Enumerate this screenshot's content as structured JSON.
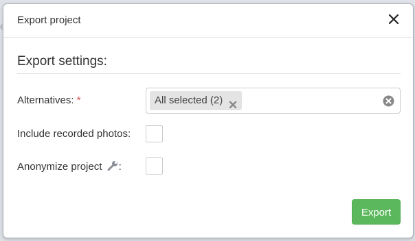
{
  "modal": {
    "title": "Export project",
    "close_icon": "close-icon"
  },
  "settings": {
    "heading": "Export settings:",
    "alternatives": {
      "label": "Alternatives:",
      "required_mark": "*",
      "selected_tag": "All selected (2)",
      "tag_remove_icon": "x-icon",
      "clear_icon": "clear-circle-icon"
    },
    "include_photos": {
      "label": "Include recorded photos:",
      "checked": false
    },
    "anonymize": {
      "label": "Anonymize project",
      "icon": "wrench-icon",
      "suffix": ":",
      "checked": false
    }
  },
  "footer": {
    "export_label": "Export"
  },
  "colors": {
    "export_button": "#5cb85c",
    "required": "#d9534f",
    "tag_background": "#e4e4e4"
  }
}
